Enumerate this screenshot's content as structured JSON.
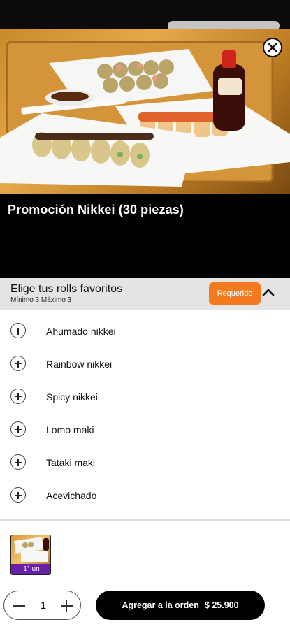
{
  "product": {
    "title": "Promoción Nikkei (30 piezas)"
  },
  "options_group": {
    "title": "Elige tus rolls favoritos",
    "constraints": "Mínimo 3 Máximo 3",
    "required_label": "Requerido",
    "items": [
      {
        "label": "Ahumado nikkei",
        "icon": "plus-circle-icon"
      },
      {
        "label": "Rainbow nikkei",
        "icon": "plus-circle-icon"
      },
      {
        "label": "Spicy nikkei",
        "icon": "plus-circle-icon"
      },
      {
        "label": "Lomo maki",
        "icon": "plus-circle-icon"
      },
      {
        "label": "Tataki maki",
        "icon": "plus-circle-icon"
      },
      {
        "label": "Acevichado",
        "icon": "plus-circle-icon"
      }
    ]
  },
  "thumbnail": {
    "tag": "1° un"
  },
  "order_bar": {
    "quantity": "1",
    "add_label": "Agregar a la orden",
    "price": "$ 25.900"
  },
  "colors": {
    "accent_orange": "#f47a20",
    "tag_purple": "#6a1fa8",
    "primary_button": "#000000"
  },
  "icons": [
    "close-icon",
    "chevron-up-icon",
    "plus-circle-icon",
    "minus-icon",
    "plus-icon"
  ]
}
